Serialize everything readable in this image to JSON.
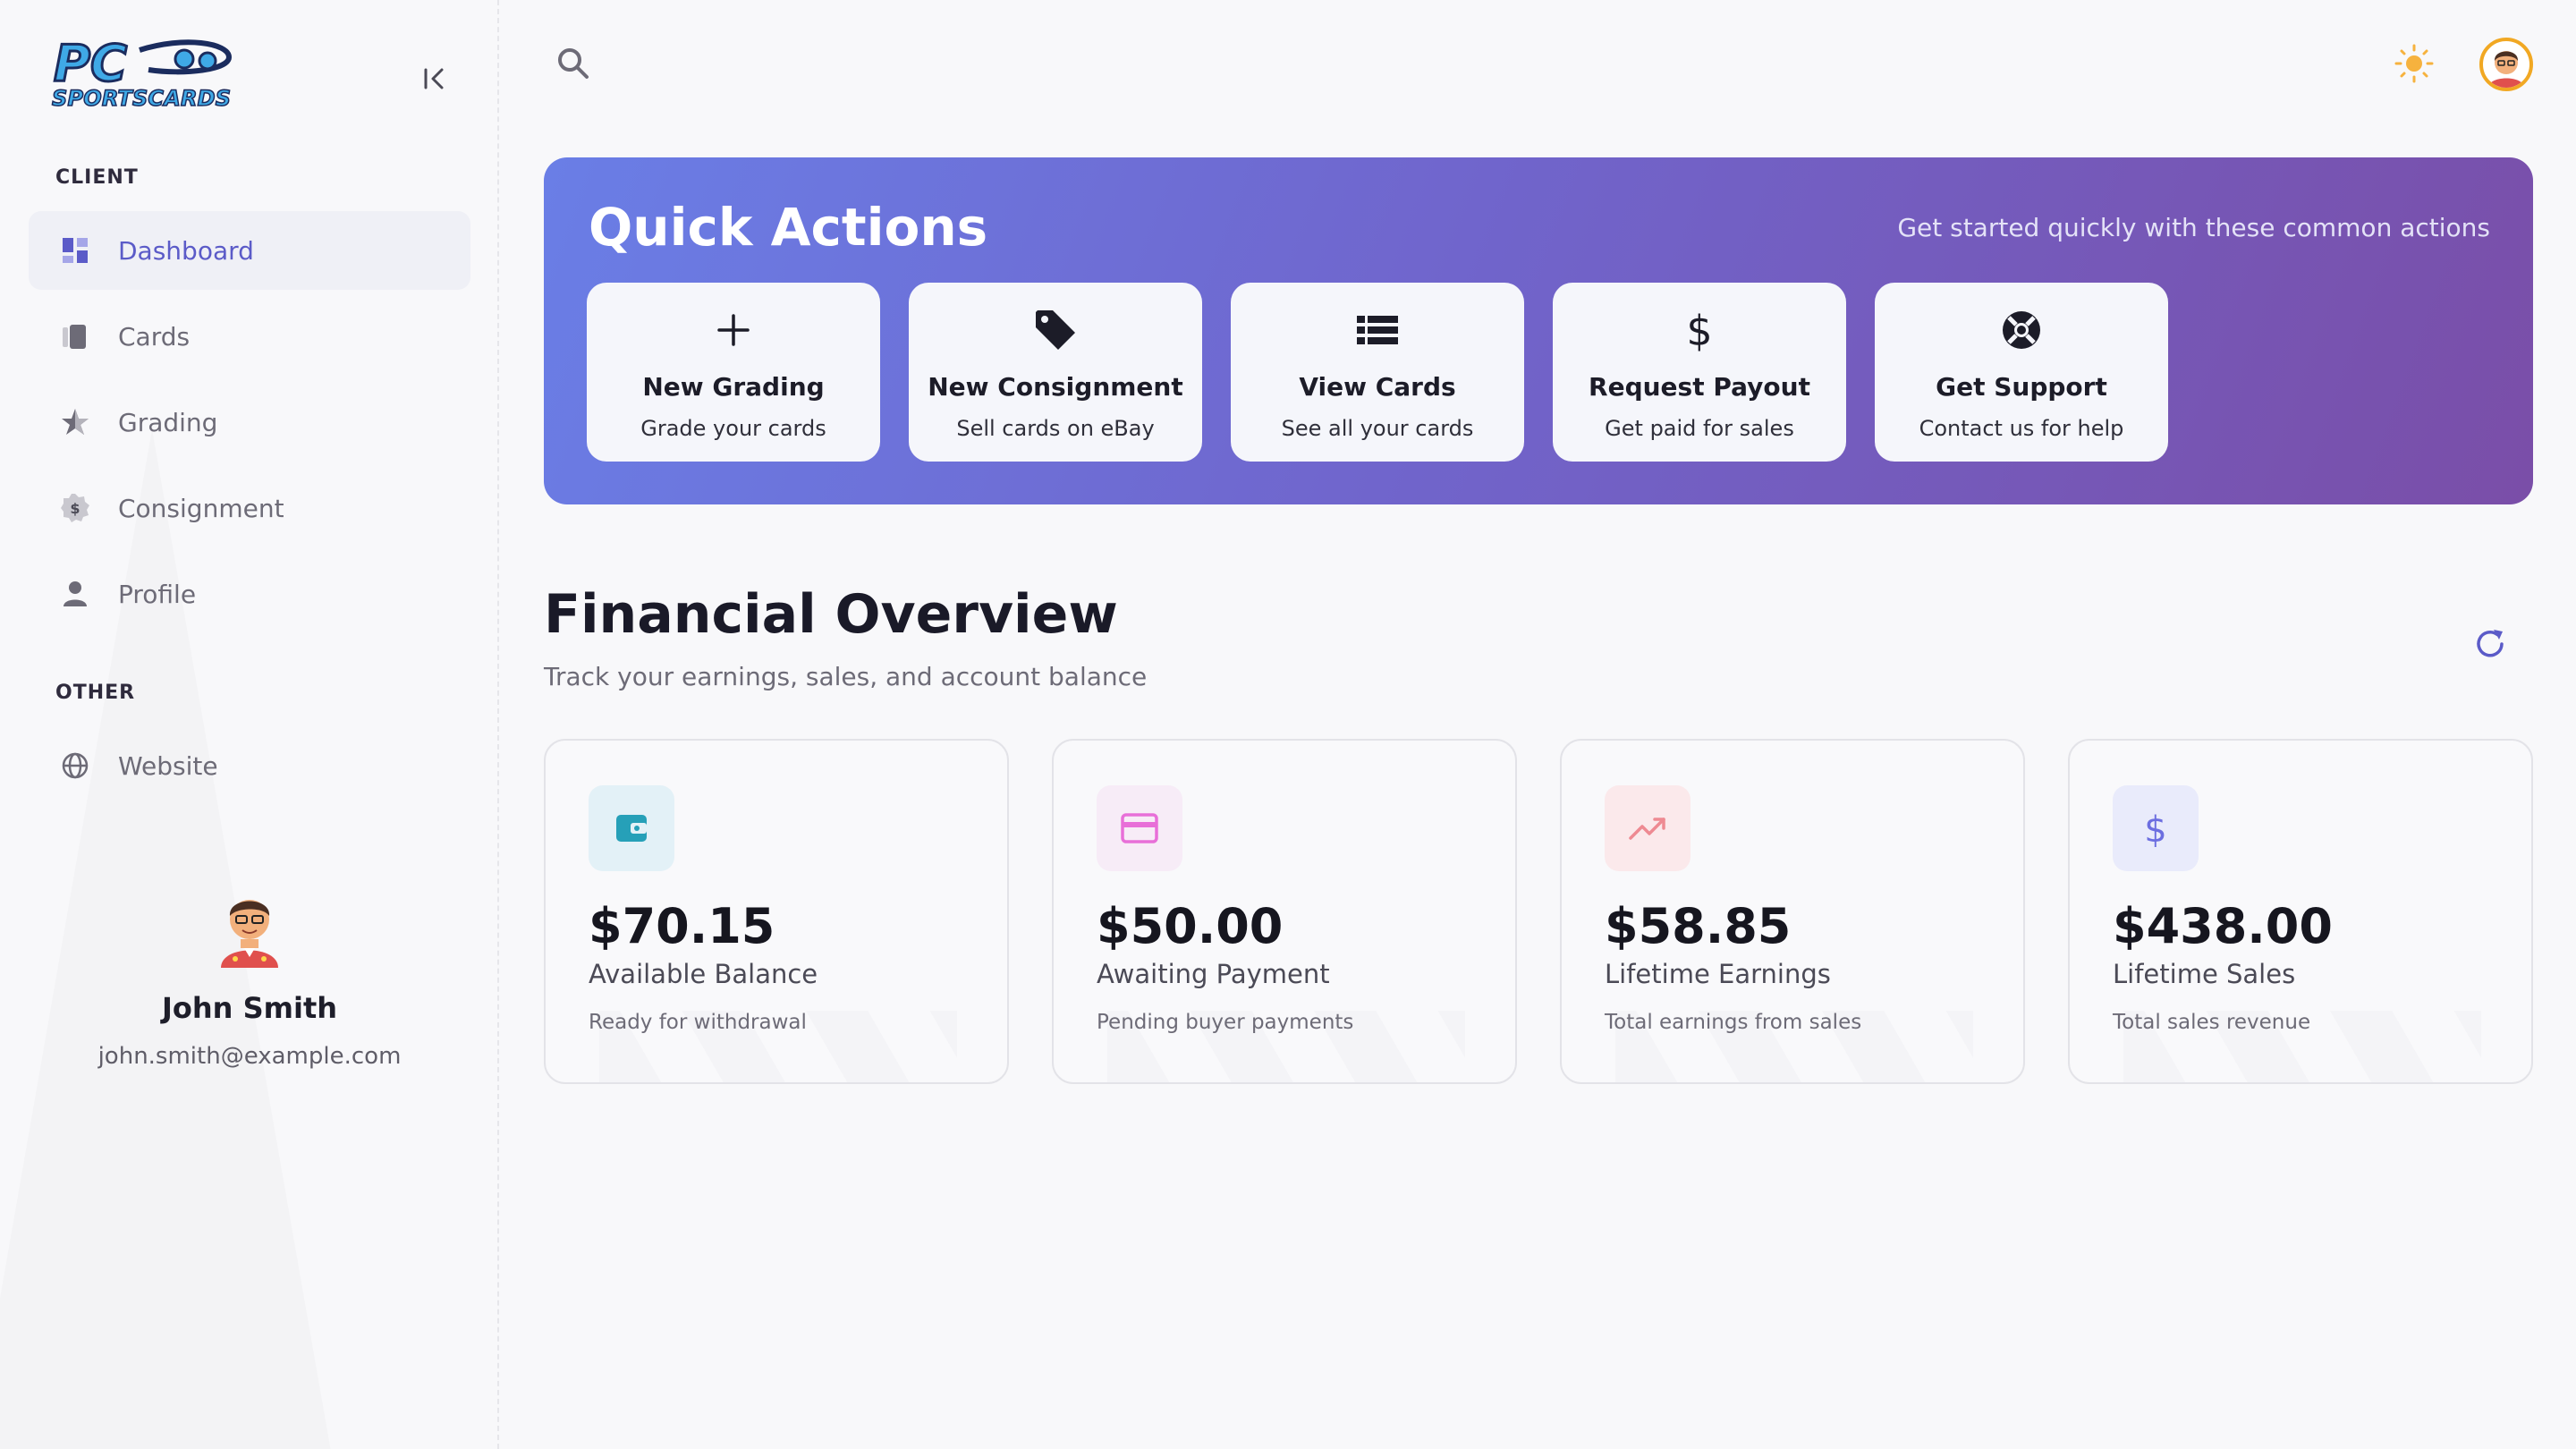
{
  "brand": {
    "logo_text_top": "PC",
    "logo_text_bottom": "SPORTSCARDS"
  },
  "sidebar": {
    "section_client": "CLIENT",
    "section_other": "OTHER",
    "items": [
      {
        "label": "Dashboard",
        "icon": "dashboard-icon",
        "active": true
      },
      {
        "label": "Cards",
        "icon": "cards-icon"
      },
      {
        "label": "Grading",
        "icon": "star-icon"
      },
      {
        "label": "Consignment",
        "icon": "dollar-badge-icon"
      },
      {
        "label": "Profile",
        "icon": "user-icon"
      }
    ],
    "other_items": [
      {
        "label": "Website",
        "icon": "globe-icon"
      }
    ],
    "user": {
      "name": "John Smith",
      "email": "john.smith@example.com"
    }
  },
  "topbar": {
    "search_icon": "search-icon",
    "theme_icon": "sun-icon",
    "avatar": "avatar"
  },
  "quick_actions": {
    "title": "Quick Actions",
    "subtitle": "Get started quickly with these common actions",
    "actions": [
      {
        "title": "New Grading",
        "subtitle": "Grade your cards",
        "icon": "plus-icon"
      },
      {
        "title": "New Consignment",
        "subtitle": "Sell cards on eBay",
        "icon": "tag-icon"
      },
      {
        "title": "View Cards",
        "subtitle": "See all your cards",
        "icon": "list-icon"
      },
      {
        "title": "Request Payout",
        "subtitle": "Get paid for sales",
        "icon": "dollar-icon"
      },
      {
        "title": "Get Support",
        "subtitle": "Contact us for help",
        "icon": "lifebuoy-icon"
      }
    ]
  },
  "financial": {
    "title": "Financial Overview",
    "subtitle": "Track your earnings, sales, and account balance",
    "cards": [
      {
        "value": "$70.15",
        "label": "Available Balance",
        "desc": "Ready for withdrawal",
        "icon": "wallet-icon",
        "color": "#26a0b8",
        "bg": "#e3f1f7"
      },
      {
        "value": "$50.00",
        "label": "Awaiting Payment",
        "desc": "Pending buyer payments",
        "icon": "credit-card-icon",
        "color": "#e86fd8",
        "bg": "#f7ecf7"
      },
      {
        "value": "$58.85",
        "label": "Lifetime Earnings",
        "desc": "Total earnings from sales",
        "icon": "trending-up-icon",
        "color": "#ee8a92",
        "bg": "#fbe9eb"
      },
      {
        "value": "$438.00",
        "label": "Lifetime Sales",
        "desc": "Total sales revenue",
        "icon": "dollar-icon",
        "color": "#6c6ee0",
        "bg": "#e9ebfb"
      }
    ]
  },
  "colors": {
    "accent": "#5b5bc8",
    "gradient_start": "#6a7ee6",
    "gradient_end": "#7a4ea8"
  }
}
